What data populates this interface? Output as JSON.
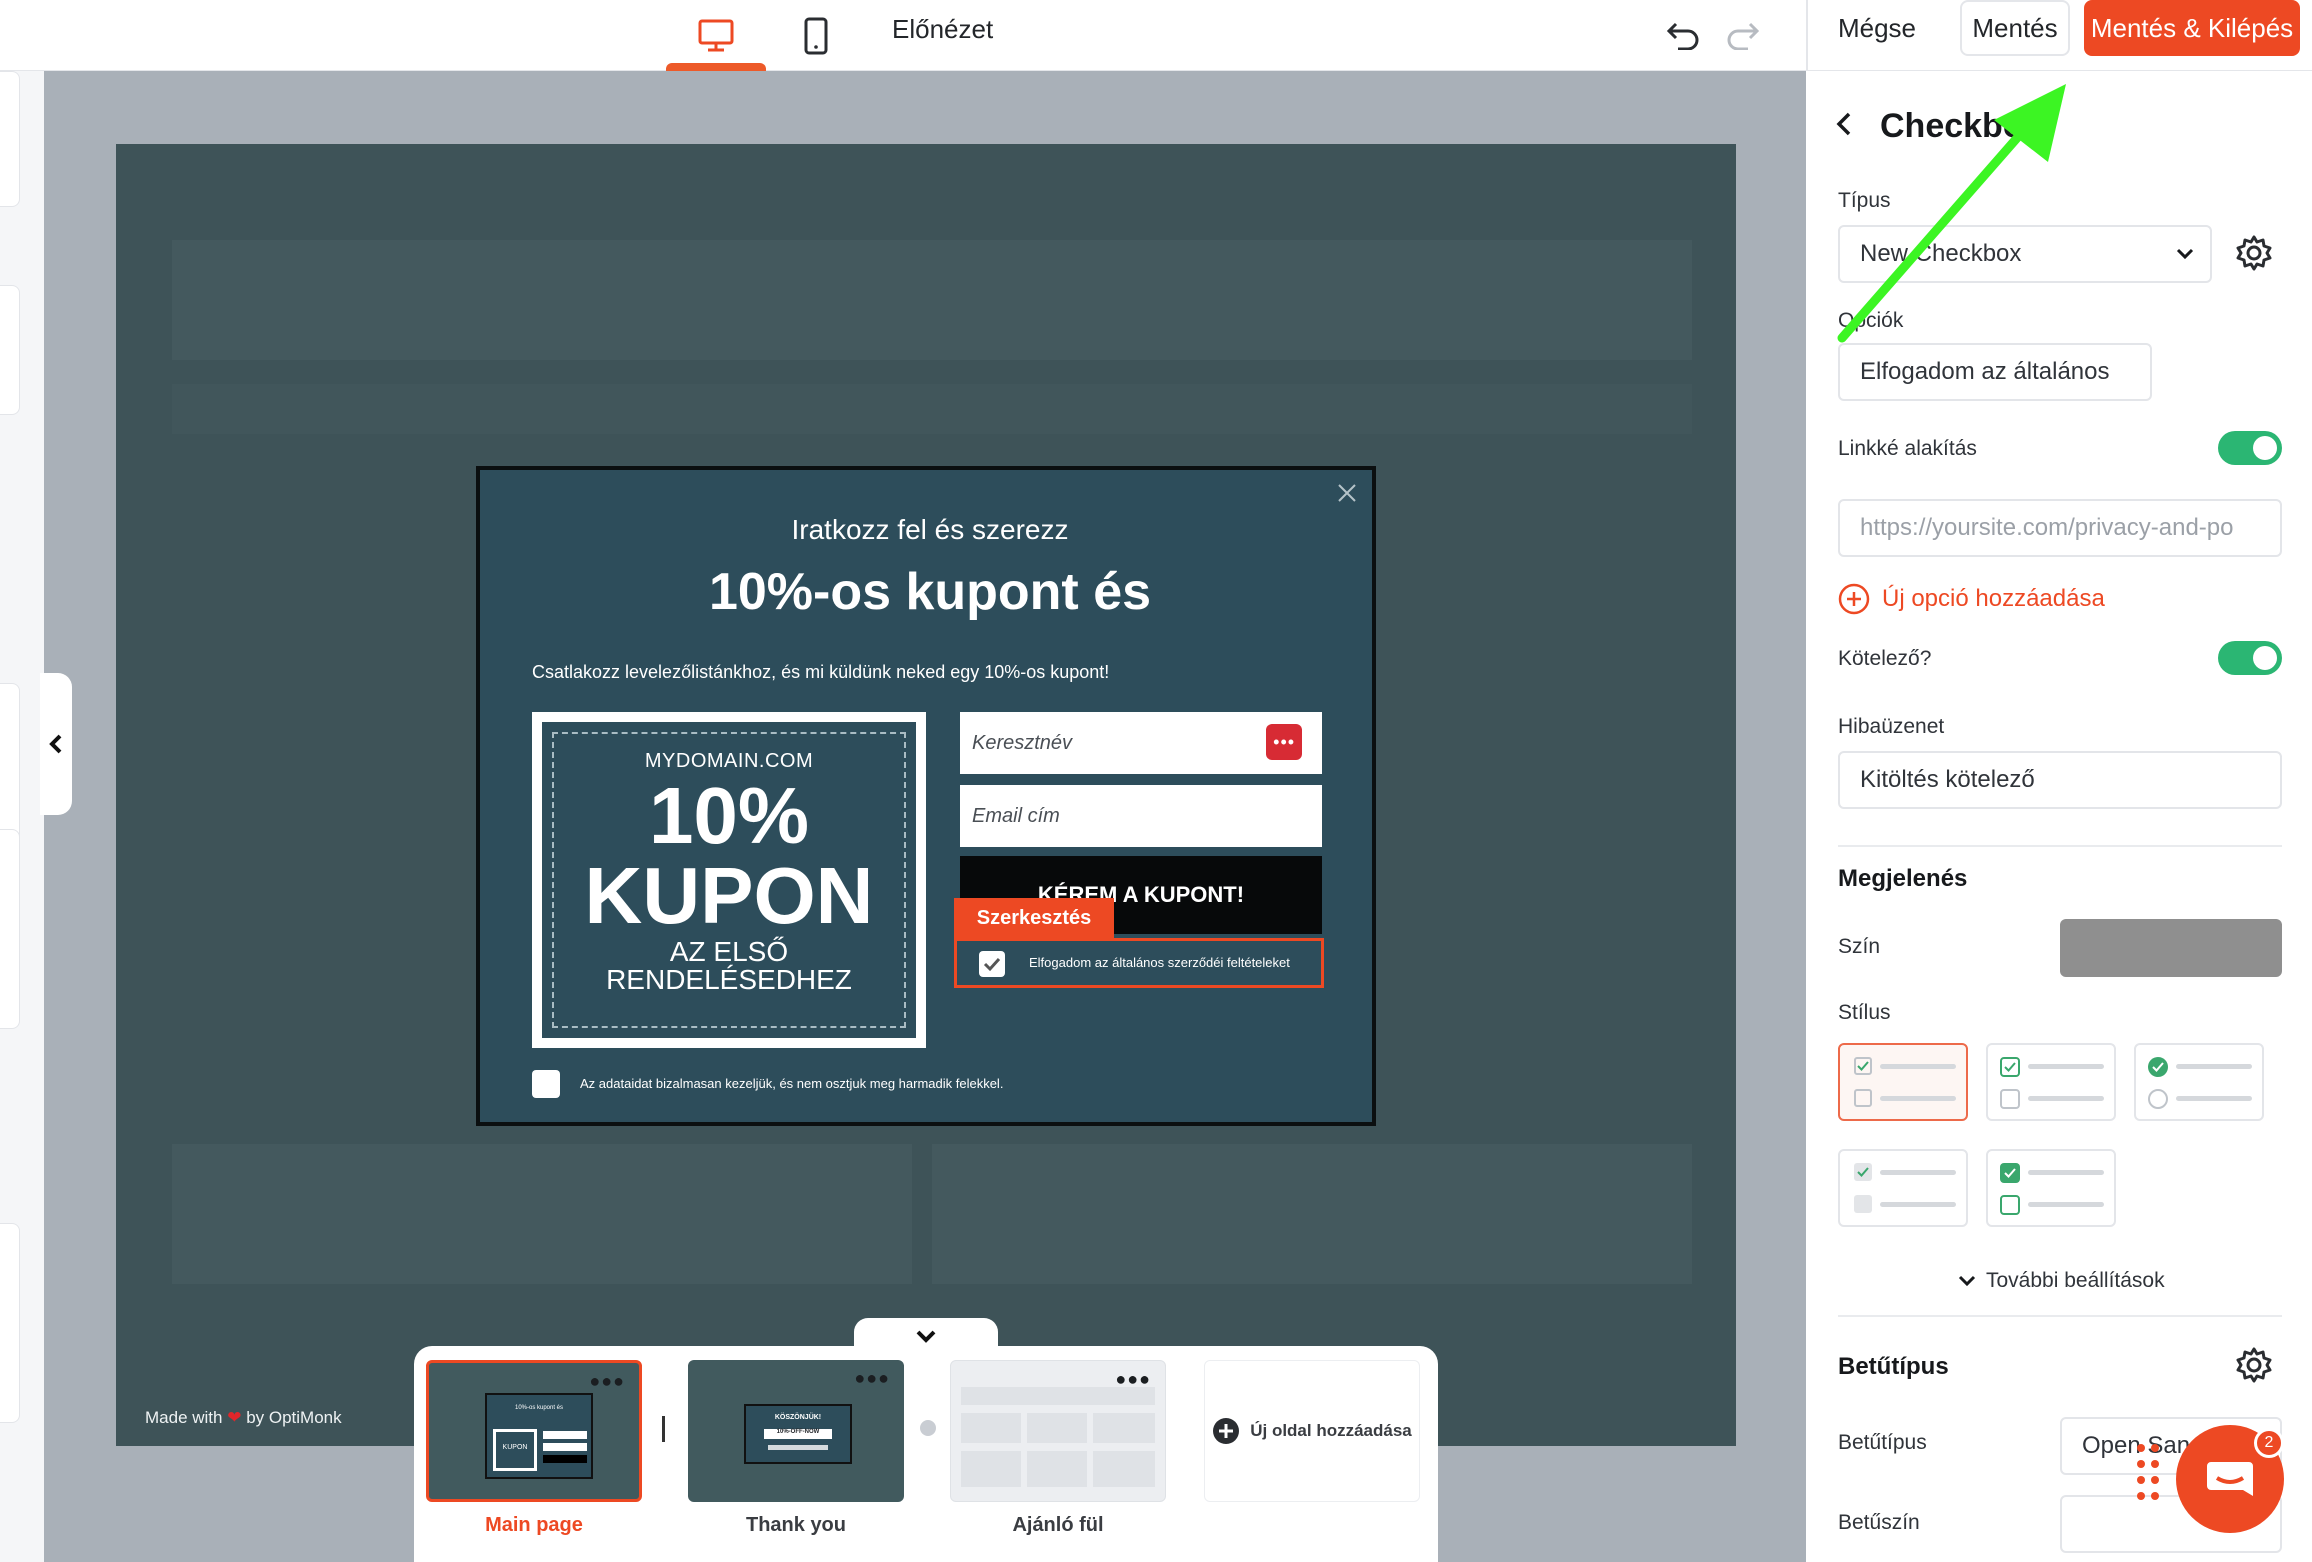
{
  "topbar": {
    "devices": [
      "desktop-icon",
      "mobile-icon"
    ],
    "preview_label": "Előnézet",
    "cancel_label": "Mégse",
    "save_label": "Mentés",
    "save_exit_label": "Mentés & Kilépés",
    "accent_color": "#ed4923"
  },
  "popup": {
    "subtitle": "Iratkozz fel és szerezz",
    "title": "10%-os kupont és",
    "description": "Csatlakozz levelezőlistánkhoz, és mi küldünk neked egy 10%-os kupont!",
    "coupon": {
      "domain": "MYDOMAIN.COM",
      "percent": "10%",
      "word": "KUPON",
      "line1": "AZ ELSŐ",
      "line2": "RENDELÉSEDHEZ"
    },
    "firstname_placeholder": "Keresztnév",
    "email_placeholder": "Email cím",
    "cta_label": "KÉREM A KUPONT!",
    "edit_tag": "Szerkesztés",
    "terms_checkbox_label": "Elfogadom az általános szerződéi feltételeket",
    "privacy_checkbox_label": "Az adataidat bizalmasan kezeljük, és nem osztjuk meg harmadik felekkel.",
    "background_color": "#2d4d5b"
  },
  "canvas": {
    "made_with_prefix": "Made with",
    "made_with_suffix": "by OptiMonk"
  },
  "pages": [
    {
      "label": "Main page",
      "active": true
    },
    {
      "label": "Thank you",
      "active": false
    },
    {
      "label": "Ajánló fül",
      "active": false
    }
  ],
  "thumbs": {
    "main_title": "10%-os kupont és",
    "main_word": "KUPON",
    "thank_title": "KÖSZÖNJÜK!",
    "thank_code": "10%-OFF-NOW"
  },
  "add_page_label": "Új oldal hozzáadása",
  "panel": {
    "title": "Checkbox",
    "type_label": "Típus",
    "type_value": "New Checkbox",
    "options_label": "Opciók",
    "option_value": "Elfogadom az általános",
    "link_label": "Linkké alakítás",
    "link_enabled": true,
    "url_placeholder": "https://yoursite.com/privacy-and-po",
    "add_option_label": "Új opció hozzáadása",
    "required_label": "Kötelező?",
    "required_enabled": true,
    "error_label": "Hibaüzenet",
    "error_value": "Kitöltés kötelező",
    "appearance_title": "Megjelenés",
    "color_label": "Szín",
    "color_value": "#8f8f8f",
    "style_label": "Stílus",
    "more_settings_label": "További beállítások",
    "font_section_title": "Betűtípus",
    "font_label": "Betűtípus",
    "font_value": "Open Sans",
    "font_color_label": "Betűszín"
  },
  "chat": {
    "badge_count": "2"
  }
}
